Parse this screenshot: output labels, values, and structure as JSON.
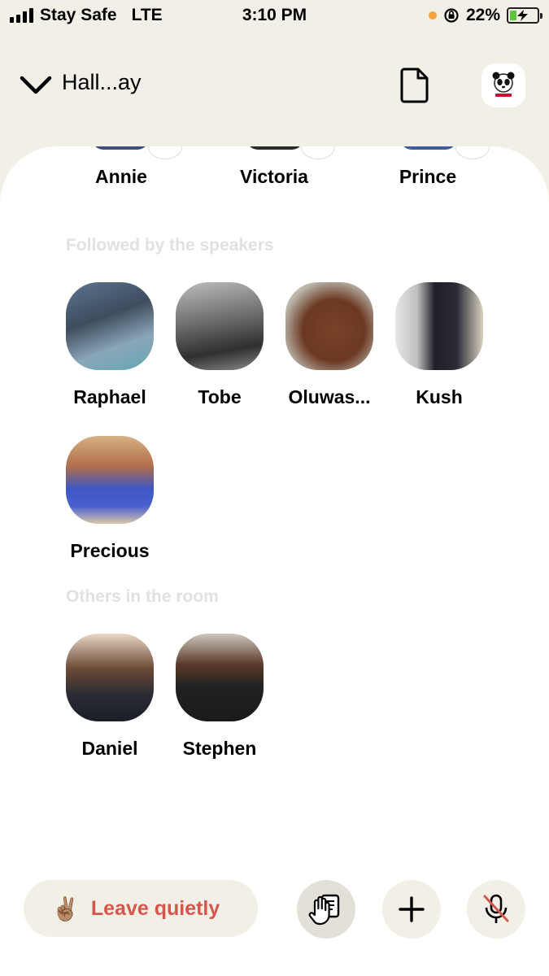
{
  "status_bar": {
    "carrier": "Stay Safe",
    "network": "LTE",
    "time": "3:10 PM",
    "battery": "22%",
    "battery_level": 0.22,
    "mic_dot_color": "#f3a33c"
  },
  "header": {
    "room_title": "Hall...ay"
  },
  "top_speakers": [
    {
      "name": "Annie"
    },
    {
      "name": "Victoria"
    },
    {
      "name": "Prince"
    }
  ],
  "sections": {
    "followed_label": "Followed by the speakers",
    "others_label": "Others in the room"
  },
  "followed": [
    {
      "name": "Raphael"
    },
    {
      "name": "Tobe"
    },
    {
      "name": "Oluwas..."
    },
    {
      "name": "Kush"
    },
    {
      "name": "Precious"
    }
  ],
  "others": [
    {
      "name": "Daniel"
    },
    {
      "name": "Stephen"
    }
  ],
  "bottom_bar": {
    "leave_emoji": "✌🏽",
    "leave_label": "Leave quietly",
    "leave_color": "#d5574c",
    "icons": [
      "raise-hand-icon",
      "plus-icon",
      "mic-muted-icon"
    ]
  }
}
